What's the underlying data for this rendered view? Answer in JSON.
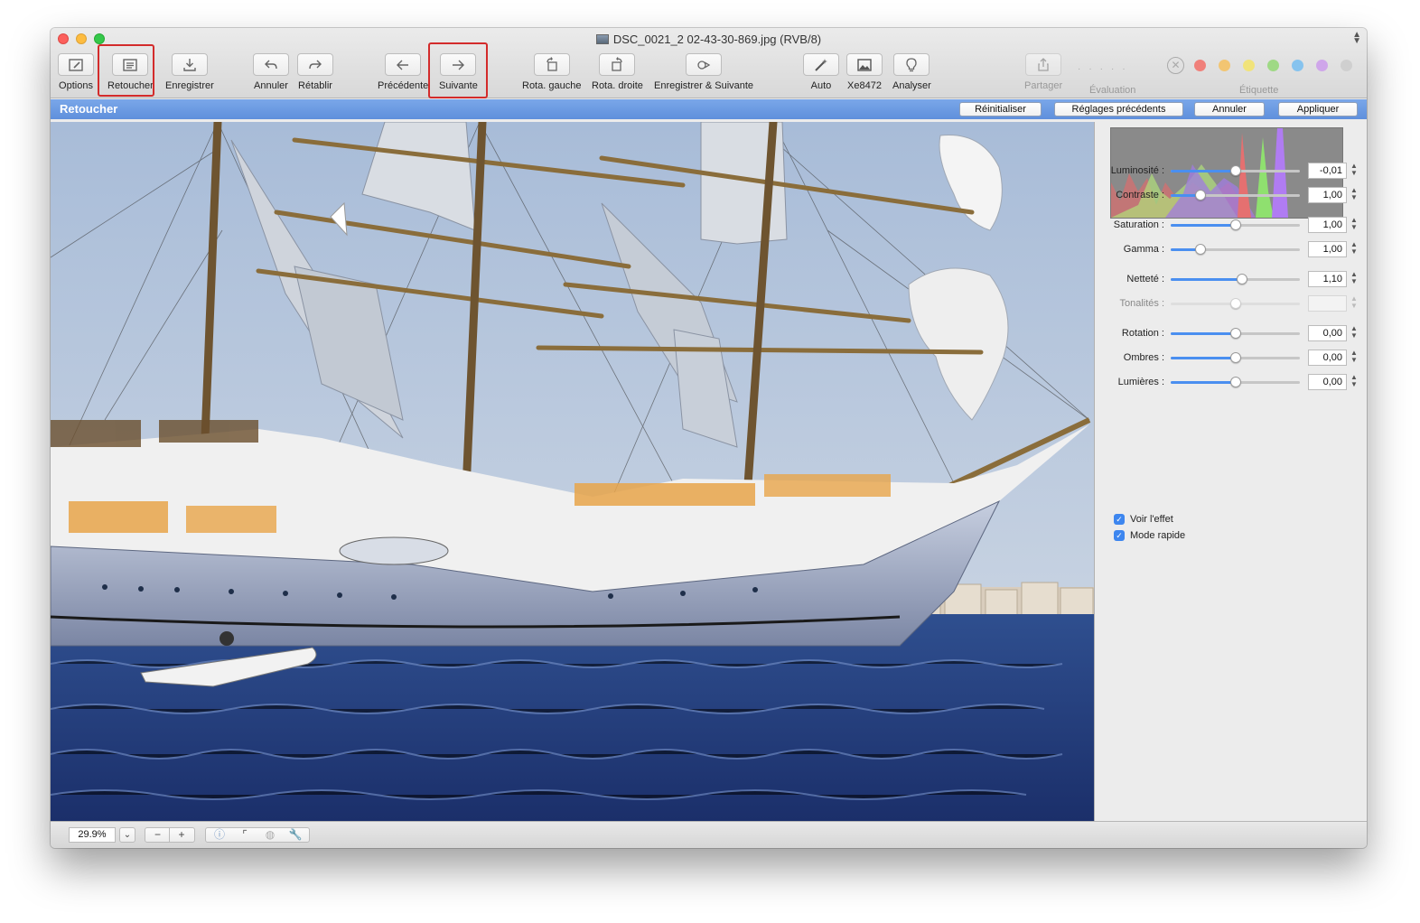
{
  "window": {
    "title": "DSC_0021_2 02-43-30-869.jpg (RVB/8)"
  },
  "toolbar": [
    {
      "label": "Options",
      "icon": "options-icon"
    },
    {
      "label": "Retoucher",
      "icon": "retouch-icon",
      "highlighted": true
    },
    {
      "label": "Enregistrer",
      "icon": "save-icon"
    },
    {
      "label": "Annuler",
      "icon": "undo-icon"
    },
    {
      "label": "Rétablir",
      "icon": "redo-icon"
    },
    {
      "label": "Précédente",
      "icon": "previous-icon"
    },
    {
      "label": "Suivante",
      "icon": "next-icon",
      "highlighted": true
    },
    {
      "label": "Rota. gauche",
      "icon": "rotate-left-icon"
    },
    {
      "label": "Rota. droite",
      "icon": "rotate-right-icon"
    },
    {
      "label": "Enregistrer & Suivante",
      "icon": "save-next-icon"
    },
    {
      "label": "Auto",
      "icon": "magic-wand-icon"
    },
    {
      "label": "Xe8472",
      "icon": "image-icon"
    },
    {
      "label": "Analyser",
      "icon": "lightbulb-icon"
    },
    {
      "label": "Partager",
      "icon": "share-icon",
      "disabled": true
    }
  ],
  "rating": {
    "label": "Évaluation"
  },
  "label_colors": {
    "label": "Étiquette",
    "colors": [
      "#f0807a",
      "#f2c572",
      "#f1e37a",
      "#9fd985",
      "#86c3ee",
      "#cfa6ea",
      "#cfcfcf"
    ]
  },
  "edit_bar": {
    "title": "Retoucher",
    "reset_label": "Réinitialiser",
    "previous_settings_label": "Réglages précédents",
    "cancel_label": "Annuler",
    "apply_label": "Appliquer"
  },
  "adjustments": [
    {
      "label": "Luminosité :",
      "value": "-0,01",
      "level": 0.5
    },
    {
      "label": "Contraste :",
      "value": "1,00",
      "level": 0.23
    },
    {
      "label": "Saturation :",
      "value": "1,00",
      "level": 0.5
    },
    {
      "label": "Gamma :",
      "value": "1,00",
      "level": 0.23
    },
    {
      "label": "Netteté :",
      "value": "1,10",
      "level": 0.55
    },
    {
      "label": "Tonalités :",
      "value": "",
      "level": 0.5,
      "disabled": true
    },
    {
      "label": "Rotation :",
      "value": "0,00",
      "level": 0.5
    },
    {
      "label": "Ombres :",
      "value": "0,00",
      "level": 0.5
    },
    {
      "label": "Lumières :",
      "value": "0,00",
      "level": 0.5
    }
  ],
  "options": {
    "show_effect_label": "Voir l'effet",
    "fast_mode_label": "Mode rapide"
  },
  "statusbar": {
    "zoom": "29.9%"
  }
}
